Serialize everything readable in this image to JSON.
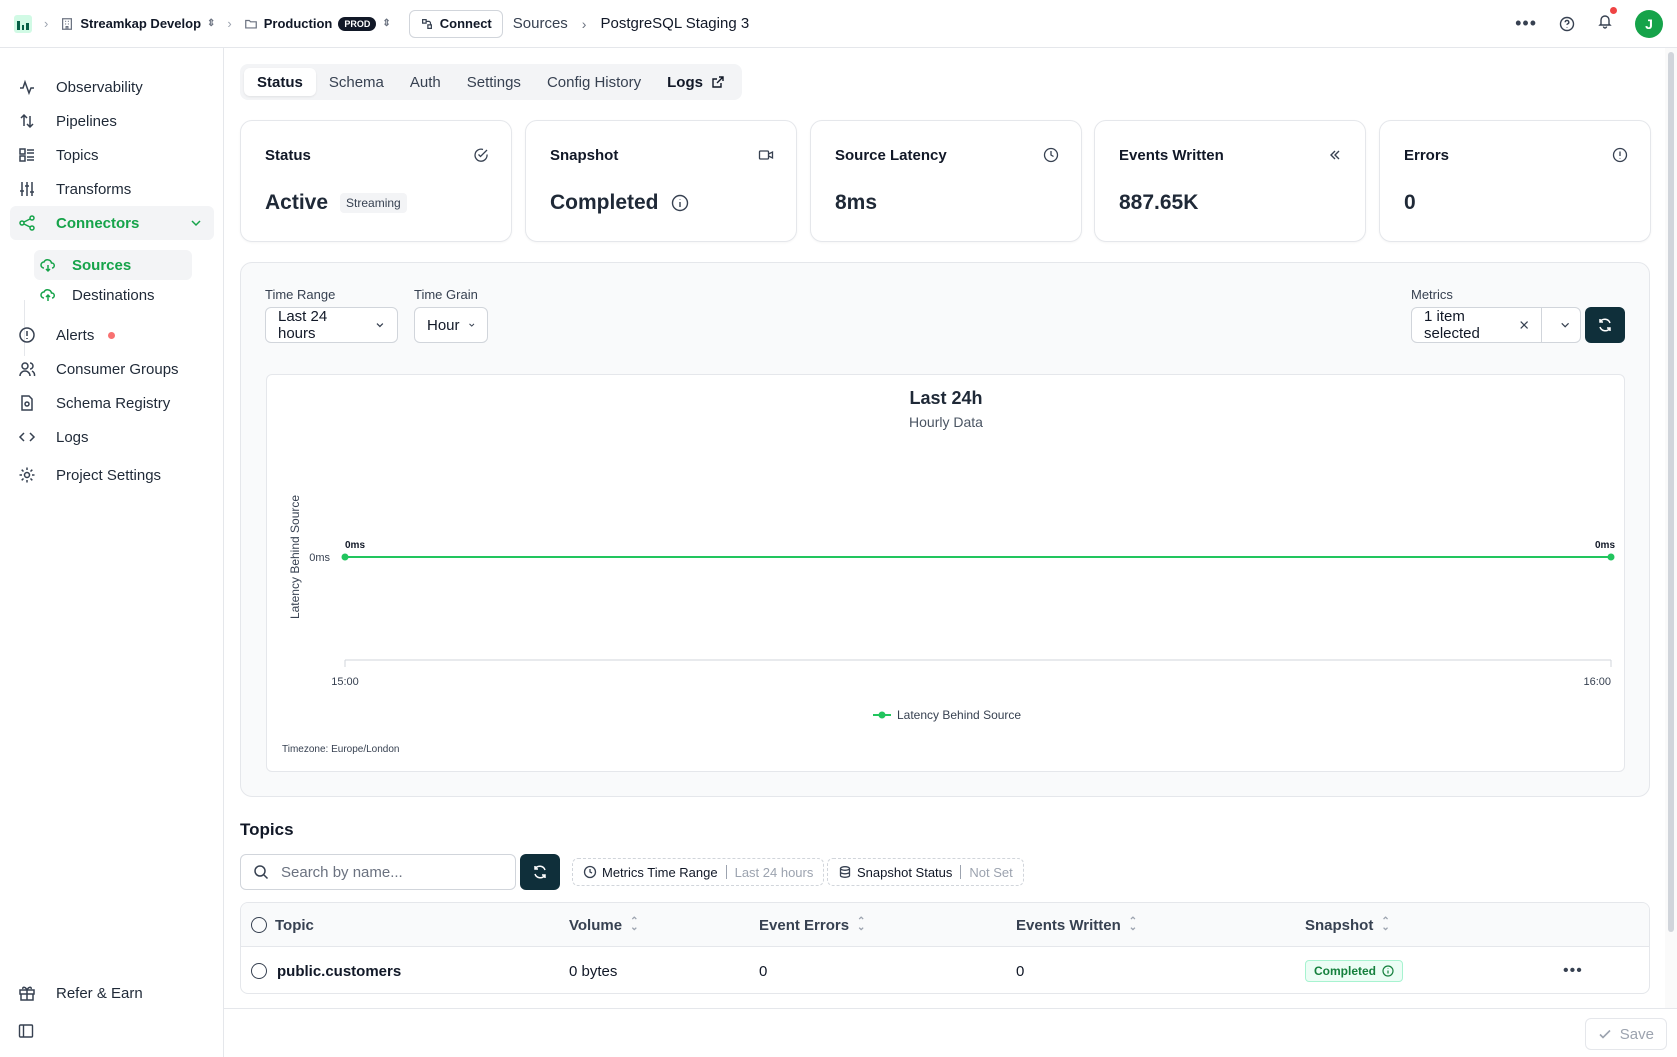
{
  "topbar": {
    "org": "Streamkap Develop",
    "project": "Production",
    "project_badge": "PROD",
    "connect": "Connect",
    "crumb_sources": "Sources",
    "crumb_current": "PostgreSQL Staging 3",
    "avatar_initial": "J"
  },
  "sidebar": {
    "items": [
      {
        "label": "Observability",
        "icon": "activity-icon"
      },
      {
        "label": "Pipelines",
        "icon": "arrows-updown-icon"
      },
      {
        "label": "Topics",
        "icon": "list-icon"
      },
      {
        "label": "Transforms",
        "icon": "sliders-icon"
      },
      {
        "label": "Connectors",
        "icon": "share-icon"
      },
      {
        "label": "Sources",
        "icon": "cloud-download-icon"
      },
      {
        "label": "Destinations",
        "icon": "cloud-upload-icon"
      },
      {
        "label": "Alerts",
        "icon": "alert-circle-icon"
      },
      {
        "label": "Consumer Groups",
        "icon": "users-icon"
      },
      {
        "label": "Schema Registry",
        "icon": "file-icon"
      },
      {
        "label": "Logs",
        "icon": "code-icon"
      },
      {
        "label": "Project Settings",
        "icon": "gear-icon"
      }
    ],
    "refer": "Refer & Earn"
  },
  "tabs": [
    "Status",
    "Schema",
    "Auth",
    "Settings",
    "Config History",
    "Logs"
  ],
  "cards": [
    {
      "title": "Status",
      "value": "Active",
      "badge": "Streaming"
    },
    {
      "title": "Snapshot",
      "value": "Completed"
    },
    {
      "title": "Source Latency",
      "value": "8ms"
    },
    {
      "title": "Events Written",
      "value": "887.65K"
    },
    {
      "title": "Errors",
      "value": "0"
    }
  ],
  "filters": {
    "time_range_label": "Time Range",
    "time_range_value": "Last 24 hours",
    "time_grain_label": "Time Grain",
    "time_grain_value": "Hour",
    "metrics_label": "Metrics",
    "metrics_value": "1 item selected"
  },
  "chart_data": {
    "type": "line",
    "title": "Last 24h",
    "subtitle": "Hourly Data",
    "ylabel": "Latency Behind Source",
    "y_tick": "0ms",
    "x": [
      "15:00",
      "16:00"
    ],
    "series": [
      {
        "name": "Latency Behind Source",
        "values": [
          0,
          0
        ],
        "point_labels": [
          "0ms",
          "0ms"
        ],
        "color": "#22c55e"
      }
    ],
    "timezone": "Timezone: Europe/London",
    "grid": false,
    "legend": "bottom-center"
  },
  "topics": {
    "title": "Topics",
    "search_placeholder": "Search by name...",
    "chip1_label": "Metrics Time Range",
    "chip1_value": "Last 24 hours",
    "chip2_label": "Snapshot Status",
    "chip2_value": "Not Set",
    "columns": [
      "Topic",
      "Volume",
      "Event Errors",
      "Events Written",
      "Snapshot"
    ],
    "rows": [
      {
        "topic": "public.customers",
        "volume": "0 bytes",
        "errors": "0",
        "written": "0",
        "snapshot": "Completed"
      }
    ]
  },
  "footer": {
    "save": "Save"
  }
}
